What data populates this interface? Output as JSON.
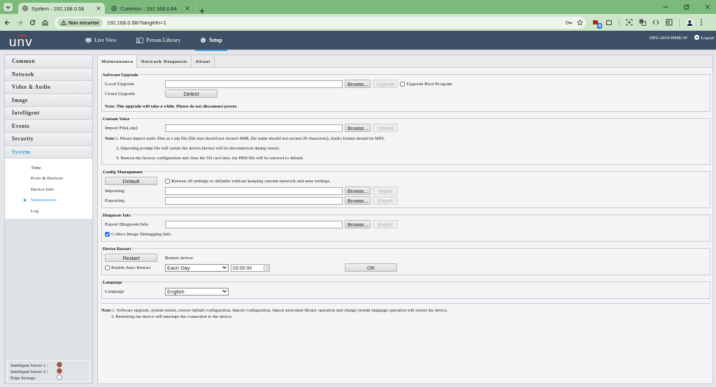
{
  "browser": {
    "tabs": [
      {
        "title": "System - 192.168.0.58",
        "selected": true
      },
      {
        "title": "Common - 192.168.0.84",
        "selected": false
      }
    ],
    "security": "Non sécurisé",
    "url": "192.168.0.58/?langinfo=1",
    "extension_badge": "4"
  },
  "header": {
    "logo": "unv",
    "nav": [
      {
        "label": "Live View",
        "selected": false
      },
      {
        "label": "Person Library",
        "selected": false
      },
      {
        "label": "Setup",
        "selected": true
      }
    ],
    "device": "OEU-201S-HMK-W",
    "logout": "Logout"
  },
  "sidebar": {
    "menu": [
      {
        "label": "Common",
        "selected": false
      },
      {
        "label": "Network",
        "selected": false
      },
      {
        "label": "Video & Audio",
        "selected": false
      },
      {
        "label": "Image",
        "selected": false
      },
      {
        "label": "Intelligent",
        "selected": false
      },
      {
        "label": "Events",
        "selected": false
      },
      {
        "label": "Security",
        "selected": false
      },
      {
        "label": "System",
        "selected": true,
        "children": [
          {
            "label": "Time",
            "selected": false
          },
          {
            "label": "Ports & Devices",
            "selected": false
          },
          {
            "label": "Device Info",
            "selected": false
          },
          {
            "label": "Maintenance",
            "selected": true
          },
          {
            "label": "Log",
            "selected": false
          }
        ]
      }
    ],
    "status": [
      {
        "label": "Intelligent Server 1 :",
        "color": "#b84a32"
      },
      {
        "label": "Intelligent Server 2 :",
        "color": "#b84a32"
      },
      {
        "label": "Edge Storage:",
        "color": "#ffffff"
      }
    ]
  },
  "tabs": [
    {
      "label": "Maintenance",
      "selected": true
    },
    {
      "label": "Network Diagnosis",
      "selected": false
    },
    {
      "label": "About",
      "selected": false
    }
  ],
  "sections": [
    {
      "title": "Software Upgrade",
      "rows": [
        {
          "kind": "fields",
          "lead": {
            "kind": "label",
            "text": "Local Upgrade"
          },
          "items": [
            {
              "kind": "field"
            },
            {
              "kind": "button",
              "label": "Browse...",
              "disabled": false
            },
            {
              "kind": "button",
              "label": "Upgrade",
              "disabled": true
            },
            {
              "kind": "checkbox",
              "label": "Upgrade Boot Program",
              "checked": false
            }
          ]
        },
        {
          "kind": "fields",
          "lead": {
            "kind": "label",
            "text": "Cloud Upgrade"
          },
          "items": [
            {
              "kind": "wide-button",
              "label": "Detect",
              "disabled": false
            }
          ]
        },
        {
          "kind": "bold-note",
          "text": "Note: The upgrade will take a while. Please do not disconnect power."
        }
      ]
    },
    {
      "title": "Custom Voice",
      "rows": [
        {
          "kind": "fields",
          "lead": {
            "kind": "label",
            "text": "Import File(.zip)"
          },
          "items": [
            {
              "kind": "field"
            },
            {
              "kind": "button",
              "label": "Browse...",
              "disabled": false
            },
            {
              "kind": "button",
              "label": "Upload",
              "disabled": true
            }
          ]
        },
        {
          "kind": "note",
          "text": "**Note:**1. Please import audio files as a zip file (file size should not exceed 4MB, file name should not exceed 20 characters). Audio format should be MP3."
        },
        {
          "kind": "note-line",
          "text": "2. Importing prompt file will restart the device.Device will be disconnected during restart."
        },
        {
          "kind": "note-line",
          "text": "3. Restore the factory configuration and clear the SD card data, the HMI file will be restored to default."
        }
      ]
    },
    {
      "title": "Config Management",
      "rows": [
        {
          "kind": "fields",
          "lead": {
            "kind": "wide-button",
            "label": "Default",
            "disabled": false
          },
          "items": [
            {
              "kind": "checkbox",
              "label": "Restore all settings to defaults without keeping current network and user settings.",
              "checked": false
            }
          ]
        },
        {
          "kind": "fields",
          "lead": {
            "kind": "label",
            "text": "Importing"
          },
          "items": [
            {
              "kind": "field"
            },
            {
              "kind": "button",
              "label": "Browse...",
              "disabled": false
            },
            {
              "kind": "button",
              "label": "Import",
              "disabled": true
            }
          ]
        },
        {
          "kind": "fields",
          "lead": {
            "kind": "label",
            "text": "Exporting"
          },
          "items": [
            {
              "kind": "field"
            },
            {
              "kind": "button",
              "label": "Browse...",
              "disabled": false
            },
            {
              "kind": "button",
              "label": "Export",
              "disabled": true
            }
          ]
        }
      ]
    },
    {
      "title": "Diagnosis Info",
      "rows": [
        {
          "kind": "fields",
          "lead": {
            "kind": "label",
            "text": "Export Diagnosis Info"
          },
          "items": [
            {
              "kind": "field"
            },
            {
              "kind": "button",
              "label": "Browse...",
              "disabled": false
            },
            {
              "kind": "button",
              "label": "Export",
              "disabled": true
            }
          ]
        },
        {
          "kind": "fields",
          "lead": {
            "kind": "checkbox",
            "label": "Collect Image Debugging Info",
            "checked": true
          },
          "items": []
        }
      ]
    },
    {
      "title": "Device Restart",
      "rows": [
        {
          "kind": "fields",
          "lead": {
            "kind": "wide-button",
            "label": "Restart",
            "disabled": false
          },
          "items": [
            {
              "kind": "label",
              "text": "Restart device"
            }
          ]
        },
        {
          "kind": "fields",
          "lead": {
            "kind": "checkbox",
            "label": "Enable Auto Restart",
            "checked": false
          },
          "items": [
            {
              "kind": "select",
              "value": "Each Day"
            },
            {
              "kind": "time",
              "value": "02:00:00"
            },
            {
              "kind": "wide-button",
              "label": "OK",
              "disabled": false
            }
          ]
        }
      ]
    },
    {
      "title": "Language",
      "rows": [
        {
          "kind": "fields",
          "lead": {
            "kind": "label",
            "text": "Language"
          },
          "items": [
            {
              "kind": "select",
              "value": "English"
            }
          ]
        }
      ]
    }
  ],
  "footer_notes": [
    {
      "kind": "note",
      "text": "**Note:**1. Software upgrade, system restart, restore default configuration, import configuration, import personnel library operation and change system language operation will restart the device."
    },
    {
      "kind": "note-line",
      "text": "2. Restarting the device will interrupt the connection to the device."
    }
  ]
}
